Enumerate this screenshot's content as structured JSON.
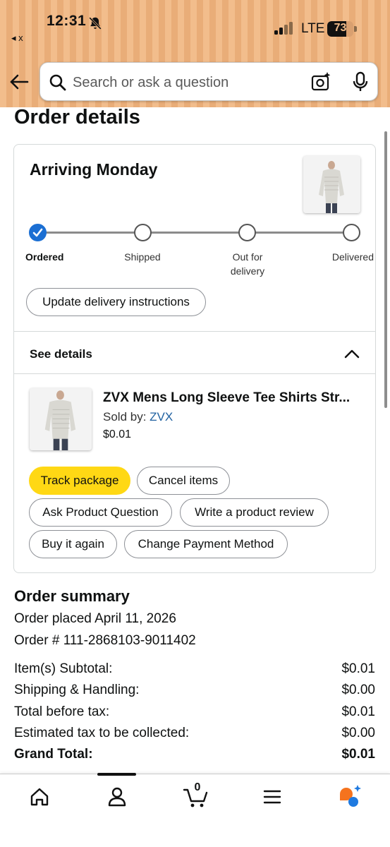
{
  "status_bar": {
    "time": "12:31",
    "back_label": "◂ x",
    "network": "LTE",
    "battery_percent": "73",
    "battery_level": 0.73
  },
  "search": {
    "placeholder": "Search or ask a question",
    "value": ""
  },
  "page": {
    "title": "Order details"
  },
  "delivery": {
    "status_title": "Arriving Monday",
    "steps": [
      {
        "label": "Ordered",
        "done": true
      },
      {
        "label": "Shipped",
        "done": false
      },
      {
        "label": "Out for delivery",
        "done": false
      },
      {
        "label": "Delivered",
        "done": false
      }
    ],
    "update_button": "Update delivery instructions"
  },
  "details": {
    "toggle_label": "See details",
    "item": {
      "title": "ZVX Mens Long Sleeve Tee Shirts Str...",
      "sold_by_label": "Sold by: ",
      "seller": "ZVX",
      "price": "$0.01"
    },
    "actions": {
      "track": "Track package",
      "cancel": "Cancel items",
      "ask": "Ask Product Question",
      "review": "Write a product review",
      "buy_again": "Buy it again",
      "change_payment": "Change Payment Method"
    }
  },
  "summary": {
    "title": "Order summary",
    "placed": "Order placed April 11, 2026",
    "order_number": "Order # 111-2868103-9011402",
    "rows": [
      {
        "label": "Item(s) Subtotal:",
        "value": "$0.01"
      },
      {
        "label": "Shipping & Handling:",
        "value": "$0.00"
      },
      {
        "label": "Total before tax:",
        "value": "$0.01"
      },
      {
        "label": "Estimated tax to be collected:",
        "value": "$0.00"
      },
      {
        "label": "Grand Total:",
        "value": "$0.01"
      }
    ]
  },
  "bottom_nav": {
    "cart_count": "0",
    "icons": [
      "home-icon",
      "account-icon",
      "cart-icon",
      "menu-icon",
      "rufus-icon"
    ]
  },
  "colors": {
    "header_bg": "#f2bd8c",
    "primary_button": "#ffd814",
    "progress_done": "#1b6fd3",
    "link": "#2162a1"
  }
}
